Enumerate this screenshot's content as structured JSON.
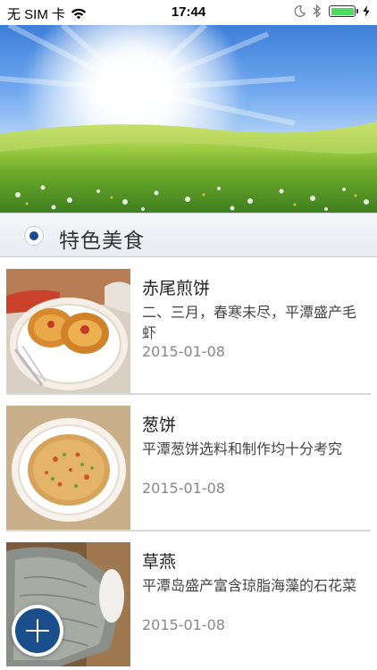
{
  "status_bar": {
    "carrier": "无 SIM 卡",
    "time": "17:44",
    "wifi_icon": "wifi-icon",
    "moon_icon": "moon-icon",
    "bluetooth_icon": "bluetooth-icon",
    "battery_level": 1.0,
    "battery_color": "#4cd964",
    "charging_icon": "charging-bolt-icon"
  },
  "banner": {
    "image": "sunny-meadow-banner"
  },
  "section": {
    "title": "特色美食",
    "accent": "#1a4b8f"
  },
  "items": [
    {
      "title": "赤尾煎饼",
      "description": "二、三月，春寒未尽，平潭盛产毛虾",
      "date": "2015-01-08",
      "image": "red-tail-pancake-photo"
    },
    {
      "title": "葱饼",
      "description": "平潭葱饼选料和制作均十分考究",
      "date": "2015-01-08",
      "image": "scallion-pancake-photo"
    },
    {
      "title": "草燕",
      "description": "平潭岛盛产富含琼脂海藻的石花菜",
      "date": "2015-01-08",
      "image": "seaweed-dish-photo"
    }
  ],
  "fab": {
    "icon": "plus-icon",
    "color": "#1b4e8c"
  }
}
